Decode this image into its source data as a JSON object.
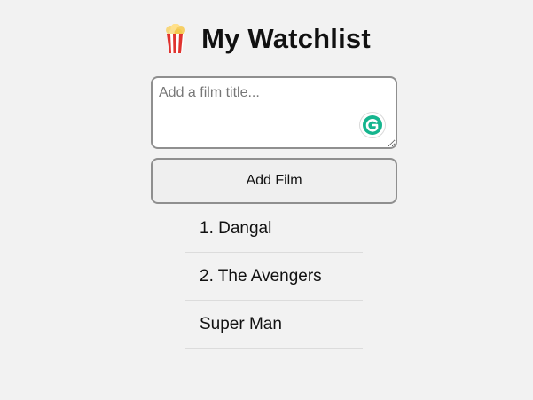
{
  "header": {
    "icon": "popcorn-icon",
    "title": "My Watchlist"
  },
  "input": {
    "placeholder": "Add a film title...",
    "value": "",
    "assistant_icon": "grammarly-icon"
  },
  "button": {
    "label": "Add Film"
  },
  "films": [
    "1. Dangal",
    "2. The Avengers",
    "Super Man"
  ],
  "colors": {
    "background": "#f2f2f2",
    "border": "#8f8f8f",
    "divider": "#dcdcdc",
    "grammarly": "#15b58e"
  }
}
